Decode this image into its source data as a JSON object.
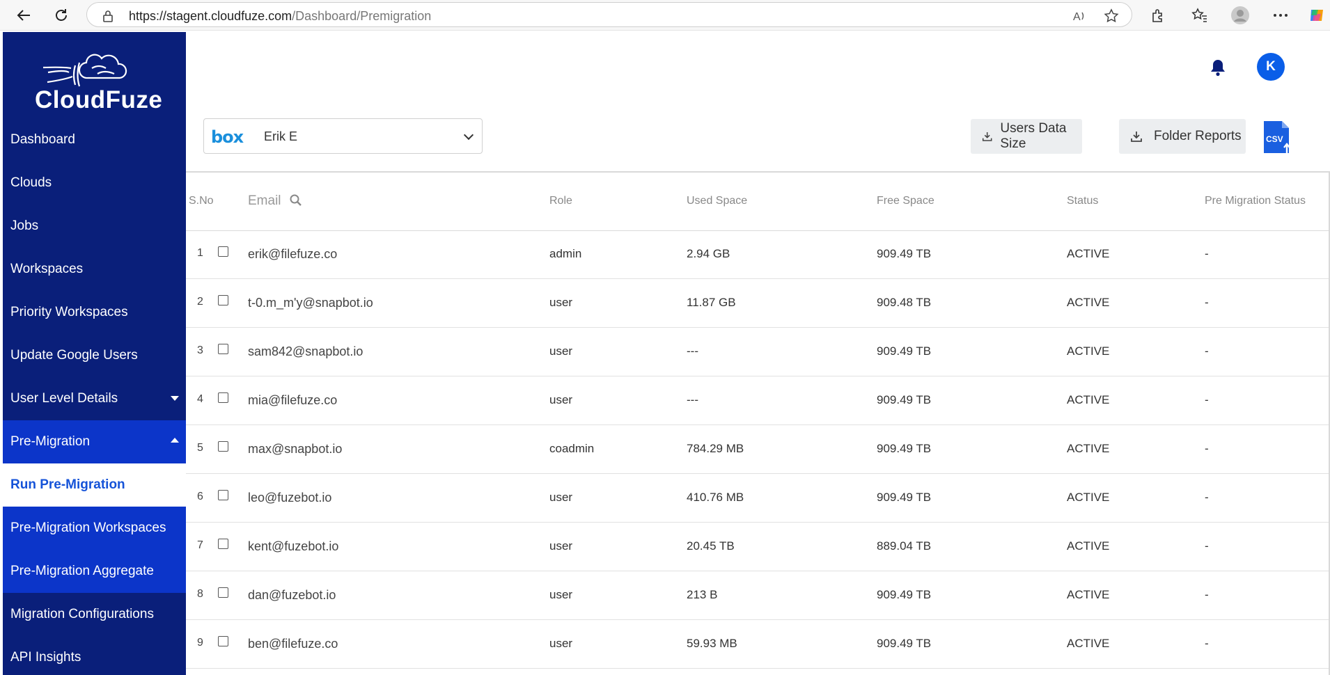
{
  "browser": {
    "url_host": "https://stagent.cloudfuze.com",
    "url_path": "/Dashboard/Premigration"
  },
  "sidebar": {
    "brand": "CloudFuze",
    "items": [
      {
        "label": "Dashboard"
      },
      {
        "label": "Clouds"
      },
      {
        "label": "Jobs"
      },
      {
        "label": "Workspaces"
      },
      {
        "label": "Priority Workspaces"
      },
      {
        "label": "Update Google Users"
      },
      {
        "label": "User Level Details"
      },
      {
        "label": "Pre-Migration"
      },
      {
        "label": "Run Pre-Migration"
      },
      {
        "label": "Pre-Migration Workspaces"
      },
      {
        "label": "Pre-Migration Aggregate"
      },
      {
        "label": "Migration Configurations"
      },
      {
        "label": "API Insights"
      }
    ]
  },
  "header": {
    "avatar_initial": "K"
  },
  "toolbar": {
    "cloud_logo": "box",
    "cloud_user": "Erik E",
    "users_data_size": "Users Data Size",
    "folder_reports": "Folder Reports",
    "csv_label": "CSV"
  },
  "table": {
    "columns": [
      "S.No",
      "Email",
      "Role",
      "Used Space",
      "Free Space",
      "Status",
      "Pre Migration Status"
    ],
    "rows": [
      {
        "sno": "1",
        "email": "erik@filefuze.co",
        "role": "admin",
        "used": "2.94 GB",
        "free": "909.49 TB",
        "status": "ACTIVE",
        "pre": "-"
      },
      {
        "sno": "2",
        "email": "t-0.m_m'y@snapbot.io",
        "role": "user",
        "used": "11.87 GB",
        "free": "909.48 TB",
        "status": "ACTIVE",
        "pre": "-"
      },
      {
        "sno": "3",
        "email": "sam842@snapbot.io",
        "role": "user",
        "used": "---",
        "free": "909.49 TB",
        "status": "ACTIVE",
        "pre": "-"
      },
      {
        "sno": "4",
        "email": "mia@filefuze.co",
        "role": "user",
        "used": "---",
        "free": "909.49 TB",
        "status": "ACTIVE",
        "pre": "-"
      },
      {
        "sno": "5",
        "email": "max@snapbot.io",
        "role": "coadmin",
        "used": "784.29 MB",
        "free": "909.49 TB",
        "status": "ACTIVE",
        "pre": "-"
      },
      {
        "sno": "6",
        "email": "leo@fuzebot.io",
        "role": "user",
        "used": "410.76 MB",
        "free": "909.49 TB",
        "status": "ACTIVE",
        "pre": "-"
      },
      {
        "sno": "7",
        "email": "kent@fuzebot.io",
        "role": "user",
        "used": "20.45 TB",
        "free": "889.04 TB",
        "status": "ACTIVE",
        "pre": "-"
      },
      {
        "sno": "8",
        "email": "dan@fuzebot.io",
        "role": "user",
        "used": "213 B",
        "free": "909.49 TB",
        "status": "ACTIVE",
        "pre": "-"
      },
      {
        "sno": "9",
        "email": "ben@filefuze.co",
        "role": "user",
        "used": "59.93 MB",
        "free": "909.49 TB",
        "status": "ACTIVE",
        "pre": "-"
      }
    ]
  }
}
